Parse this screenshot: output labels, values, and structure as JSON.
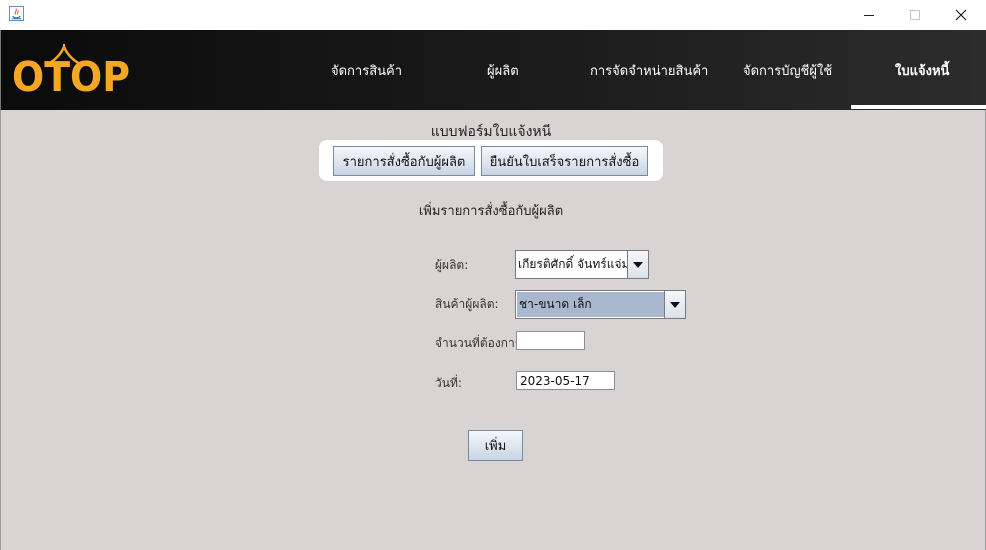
{
  "window": {
    "minimize_icon": "minimize-icon",
    "maximize_icon": "maximize-icon",
    "close_icon": "close-icon"
  },
  "logo": {
    "text": "OTOP",
    "color": "#f5a623"
  },
  "nav": {
    "items": [
      {
        "label": "จัดการสินค้า"
      },
      {
        "label": "ผู้ผลิต"
      },
      {
        "label": "การจัดจำหน่ายสินค้า"
      },
      {
        "label": "จัดการบัญชีผู้ใช้"
      },
      {
        "label": "ใบแจ้งหนี้",
        "active": true
      }
    ]
  },
  "form": {
    "title": "แบบฟอร์มใบแจ้งหนี",
    "tabs": [
      {
        "label": "รายการสั่งซื้อกับผู้ผลิต"
      },
      {
        "label": "ยืนยันใบเสร็จรายการสั่งซื้อ"
      }
    ],
    "section_title": "เพิ่มรายการสั่งซื้อกับผู้ผลิต",
    "fields": {
      "maker": {
        "label": "ผู้ผลิต:",
        "value": "เกียรติศักดิ์ จันทร์แจ่ม"
      },
      "product": {
        "label": "สินค้าผู้ผลิต:",
        "value": "ชา-ขนาด เล็ก"
      },
      "quantity": {
        "label": "จำนวนที่ต้องการ:",
        "value": ""
      },
      "date": {
        "label": "วันที่:",
        "value": "2023-05-17"
      }
    },
    "add_label": "เพิ่ม"
  }
}
